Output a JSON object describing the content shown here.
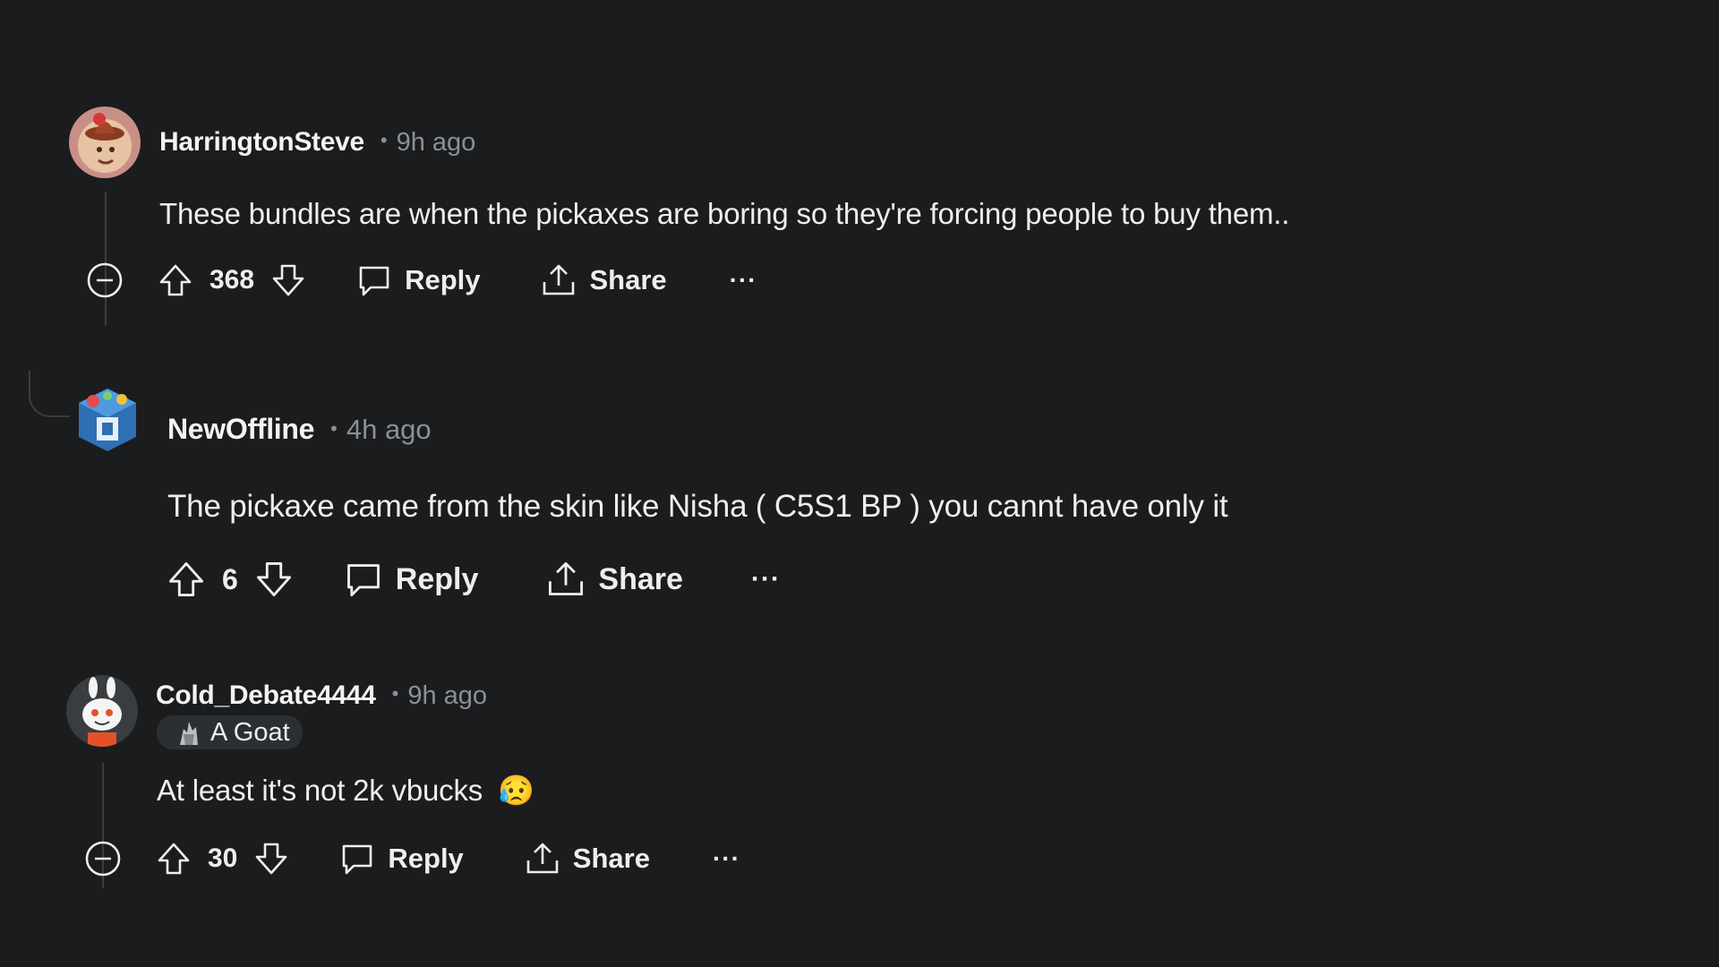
{
  "comments": [
    {
      "username": "HarringtonSteve",
      "separator": "•",
      "time": "9h ago",
      "body": "These bundles are when the pickaxes are boring so they're forcing people to buy them..",
      "score": "368",
      "reply_label": "Reply",
      "share_label": "Share",
      "more_label": "···",
      "avatar_icon": "cowboy-avatar-icon"
    },
    {
      "username": "NewOffline",
      "separator": "•",
      "time": "4h ago",
      "body": "The pickaxe came from the skin like Nisha ( C5S1 BP ) you cannt have only it",
      "score": "6",
      "reply_label": "Reply",
      "share_label": "Share",
      "more_label": "···",
      "avatar_icon": "game-character-avatar-icon"
    },
    {
      "username": "Cold_Debate4444",
      "separator": "•",
      "time": "9h ago",
      "flair": "A Goat",
      "body": "At least it's not 2k vbucks",
      "emoji": "😥",
      "score": "30",
      "reply_label": "Reply",
      "share_label": "Share",
      "more_label": "···",
      "avatar_icon": "snoo-avatar-icon"
    }
  ],
  "colors": {
    "background": "#1b1c1e",
    "text": "#eceef0",
    "muted": "#8a9095",
    "thread_line": "#3a3d40",
    "flair_bg": "#2c2f32"
  }
}
